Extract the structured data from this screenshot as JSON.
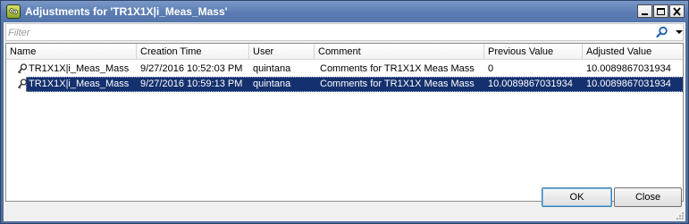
{
  "window": {
    "title": "Adjustments for 'TR1X1X|i_Meas_Mass'",
    "icon": "app-logo-icon"
  },
  "caption_buttons": {
    "minimize": "minimize-icon",
    "maximize": "maximize-icon",
    "close": "close-icon"
  },
  "filter": {
    "placeholder": "Filter",
    "value": "",
    "search_icon": "search-icon",
    "dropdown_icon": "chevron-down-icon"
  },
  "table": {
    "columns": [
      "Name",
      "Creation Time",
      "User",
      "Comment",
      "Previous Value",
      "Adjusted Value"
    ],
    "rows": [
      {
        "icon": "adjustment-icon",
        "name": "TR1X1X|i_Meas_Mass",
        "creation_time": "9/27/2016 10:52:03 PM",
        "user": "quintana",
        "comment": "Comments for TR1X1X Meas Mass",
        "previous_value": "0",
        "adjusted_value": "10.0089867031934",
        "selected": false
      },
      {
        "icon": "adjustment-icon",
        "name": "TR1X1X|i_Meas_Mass",
        "creation_time": "9/27/2016 10:59:13 PM",
        "user": "quintana",
        "comment": "Comments for TR1X1X Meas Mass",
        "previous_value": "10.0089867031934",
        "adjusted_value": "10.0089867031934",
        "selected": true
      }
    ]
  },
  "buttons": {
    "ok": "OK",
    "close": "Close"
  },
  "colors": {
    "titlebar": "#5b7db3",
    "selection": "#14306e",
    "accent": "#3c7fb1"
  }
}
